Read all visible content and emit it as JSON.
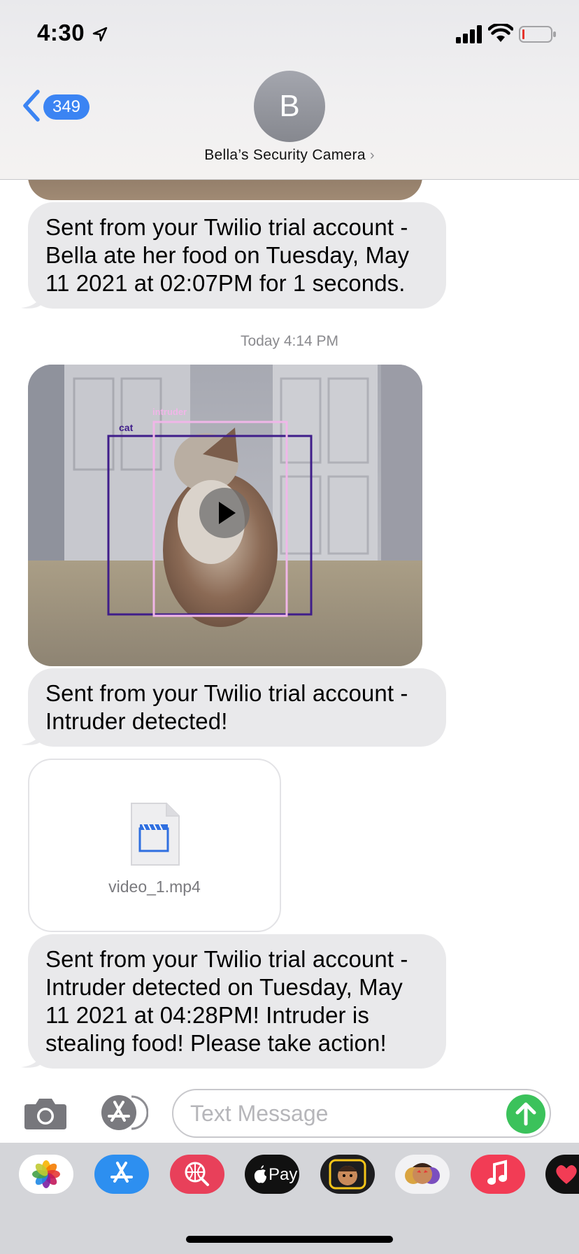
{
  "status_bar": {
    "time": "4:30"
  },
  "header": {
    "back_count": "349",
    "avatar_initial": "B",
    "contact_name": "Bella’s Security Camera",
    "contact_chevron": "›"
  },
  "messages": {
    "msg1": "Sent from your Twilio trial account - Bella ate her food on Tuesday, May 11 2021 at 02:07PM for 1 seconds.",
    "timestamp": "Today 4:14 PM",
    "video_labels": {
      "intruder": "intruder",
      "cat": "cat"
    },
    "msg2": "Sent from your Twilio trial account - Intruder detected!",
    "attachment_name": "video_1.mp4",
    "msg3": "Sent from your Twilio trial account - Intruder detected on Tuesday, May 11 2021 at 04:28PM! Intruder is stealing food! Please take action!"
  },
  "input": {
    "placeholder": "Text Message",
    "value": ""
  },
  "drawer": {
    "apple_pay_label": "Pay",
    "apps": [
      "photos-icon",
      "app-store-icon",
      "web-images-icon",
      "apple-pay-icon",
      "memoji-icon",
      "animoji-stickers-icon",
      "music-icon",
      "digital-touch-icon"
    ]
  },
  "colors": {
    "imessage_blue": "#3b84f3",
    "bubble_gray": "#e9e9eb",
    "send_green": "#3bc25b",
    "drawer_bg": "#d4d5d9"
  }
}
